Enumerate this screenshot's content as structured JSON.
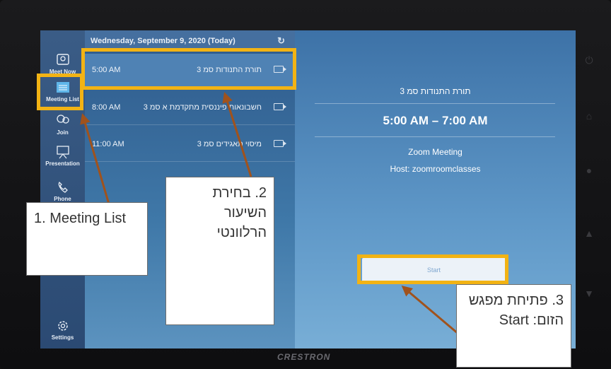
{
  "rail": {
    "items": [
      {
        "label": "Meet Now",
        "icon": "video-room-icon"
      },
      {
        "label": "Meeting List",
        "icon": "calendar-icon"
      },
      {
        "label": "Join",
        "icon": "join-icon"
      },
      {
        "label": "Presentation",
        "icon": "presentation-icon"
      },
      {
        "label": "Phone",
        "icon": "phone-icon"
      },
      {
        "label": "Settings",
        "icon": "gear-icon"
      }
    ]
  },
  "list": {
    "date_header": "Wednesday, September 9, 2020 (Today)",
    "refresh_icon": "refresh-icon",
    "meetings": [
      {
        "time": "5:00 AM",
        "title": "תורת התנודות סמ 3"
      },
      {
        "time": "8:00 AM",
        "title": "חשבונאות פיננסית מתקדמת א סמ 3"
      },
      {
        "time": "11:00 AM",
        "title": "מיסוי תאגידים סמ 3"
      }
    ]
  },
  "details": {
    "title": "תורת התנודות סמ 3",
    "time_range": "5:00 AM – 7:00 AM",
    "meeting_type": "Zoom Meeting",
    "host": "Host: zoomroomclasses",
    "start_label": "Start"
  },
  "device": {
    "brand": "CRESTRON",
    "buttons": [
      "power-icon",
      "home-icon",
      "lightbulb-icon",
      "volume-up-icon",
      "volume-down-icon"
    ]
  },
  "annotations": {
    "callout1": "1. Meeting List",
    "callout2": "2. בחירת השיעור הרלוונטי",
    "callout3": "3. פתיחת מפגש הזום: Start",
    "highlight_color": "#f2b314",
    "arrow_color": "#a0521c"
  }
}
